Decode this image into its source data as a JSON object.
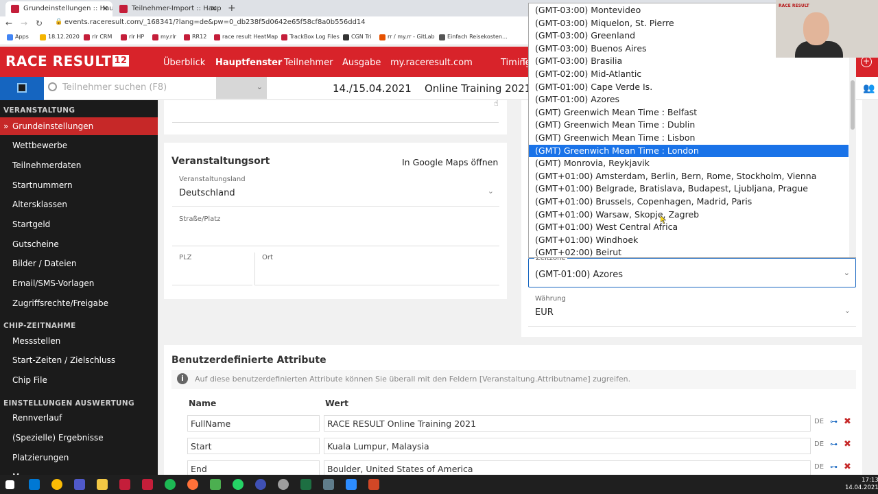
{
  "browser": {
    "tabs": [
      {
        "title": "Grundeinstellungen :: Hauptfen"
      },
      {
        "title": "Teilnehmer-Import :: Hauptfenst"
      }
    ],
    "url": "events.raceresult.com/_168341/?lang=de&pw=0_db238f5d0642e65f58cf8a0b556dd14",
    "bookmarks": [
      "Apps",
      "18.12.2020",
      "rlr CRM",
      "rlr HP",
      "my.rlr",
      "RR12",
      "race result HeatMap",
      "TrackBox Log Files",
      "CGN Tri",
      "rr / my.rr - GitLab",
      "Einfach Reisekosten..."
    ]
  },
  "app": {
    "logo_text": "RACE RESULT",
    "logo_version": "12",
    "nav": [
      "Überblick",
      "Hauptfenster",
      "Teilnehmer",
      "Ausgabe",
      "my.raceresult.com",
      "Timing",
      "Te"
    ],
    "active_nav": "Hauptfenster"
  },
  "toolbar": {
    "search_placeholder": "Teilnehmer suchen (F8)",
    "event_date": "14./15.04.2021",
    "event_name": "Online Training 2021"
  },
  "sidebar": {
    "sections": [
      {
        "title": "VERANSTALTUNG",
        "items": [
          "Grundeinstellungen",
          "Wettbewerbe",
          "Teilnehmerdaten",
          "Startnummern",
          "Altersklassen",
          "Startgeld",
          "Gutscheine",
          "Bilder / Dateien",
          "Email/SMS-Vorlagen",
          "Zugriffsrechte/Freigabe"
        ]
      },
      {
        "title": "CHIP-ZEITNAHME",
        "items": [
          "Messstellen",
          "Start-Zeiten / Zielschluss",
          "Chip File"
        ]
      },
      {
        "title": "EINSTELLUNGEN AUSWERTUNG",
        "items": [
          "Rennverlauf",
          "(Spezielle) Ergebnisse",
          "Platzierungen",
          "M... ... ..."
        ]
      }
    ],
    "active_item": "Grundeinstellungen"
  },
  "venue": {
    "title": "Veranstaltungsort",
    "maps_link": "In Google Maps öffnen",
    "country_label": "Veranstaltungsland",
    "country_value": "Deutschland",
    "street_label": "Straße/Platz",
    "street_value": "",
    "zip_label": "PLZ",
    "zip_value": "",
    "city_label": "Ort",
    "city_value": ""
  },
  "settings": {
    "timezone_label": "Zeitzone",
    "timezone_value": "(GMT-01:00) Azores",
    "currency_label": "Währung",
    "currency_value": "EUR"
  },
  "timezone_options": [
    "(GMT-03:00) Montevideo",
    "(GMT-03:00) Miquelon, St. Pierre",
    "(GMT-03:00) Greenland",
    "(GMT-03:00) Buenos Aires",
    "(GMT-03:00) Brasilia",
    "(GMT-02:00) Mid-Atlantic",
    "(GMT-01:00) Cape Verde Is.",
    "(GMT-01:00) Azores",
    "(GMT) Greenwich Mean Time : Belfast",
    "(GMT) Greenwich Mean Time : Dublin",
    "(GMT) Greenwich Mean Time : Lisbon",
    "(GMT) Greenwich Mean Time : London",
    "(GMT) Monrovia, Reykjavik",
    "(GMT+01:00) Amsterdam, Berlin, Bern, Rome, Stockholm, Vienna",
    "(GMT+01:00) Belgrade, Bratislava, Budapest, Ljubljana, Prague",
    "(GMT+01:00) Brussels, Copenhagen, Madrid, Paris",
    "(GMT+01:00) Warsaw, Skopje, Zagreb",
    "(GMT+01:00) West Central Africa",
    "(GMT+01:00) Windhoek",
    "(GMT+02:00) Beirut"
  ],
  "timezone_highlighted": "(GMT) Greenwich Mean Time : London",
  "attributes": {
    "title": "Benutzerdefinierte Attribute",
    "info": "Auf diese benutzerdefinierten Attribute können Sie überall mit den Feldern [Veranstaltung.Attributname] zugreifen.",
    "col_name": "Name",
    "col_value": "Wert",
    "rows": [
      {
        "name": "FullName",
        "value": "RACE RESULT Online Training 2021",
        "lang": "DE"
      },
      {
        "name": "Start",
        "value": "Kuala Lumpur, Malaysia",
        "lang": "DE"
      },
      {
        "name": "End",
        "value": "Boulder, United States of America",
        "lang": "DE"
      }
    ]
  },
  "webcam": {
    "brand": "RACE RESULT"
  },
  "taskbar": {
    "time": "17:13",
    "date": "14.04.2021"
  }
}
